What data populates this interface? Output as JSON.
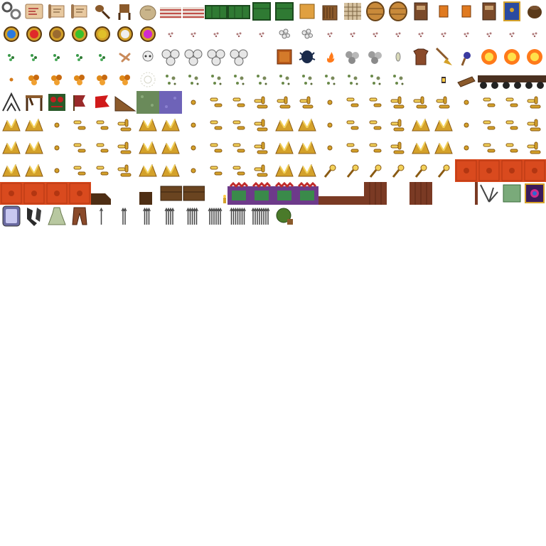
{
  "sheet": {
    "cols": 24,
    "palette": {
      "gold": "#d4a12a",
      "gold_light": "#f2d15a",
      "gold_dark": "#8a5a12",
      "paper": "#e8c9a0",
      "paper_dark": "#a07850",
      "wood": "#8b5a2b",
      "wood_dark": "#4e2e14",
      "green": "#2f7a33",
      "green_dark": "#1c4a1f",
      "stone": "#9c9c9c",
      "stone_light": "#e6e6e6",
      "fire": "#ff7a1a",
      "fire_core": "#ffe14a",
      "red_tile": "#d94a1e",
      "red_tile_dark": "#b23612",
      "purple": "#6d3a8a",
      "blue": "#2a5fb0",
      "moss": "#6a8a4a",
      "lavender": "#6e63b8"
    },
    "rows": [
      [
        "chain",
        "scroll-map",
        "scroll",
        "scroll",
        "spoon",
        "chair",
        "sack",
        "couch-striped",
        "couch-striped",
        "couch-green",
        "couch-green",
        "armchair-green",
        "armchair-green",
        "box",
        "box-open",
        "net",
        "barrel",
        "barrel",
        "book",
        "book-small",
        "book-small",
        "book",
        "book-blue",
        "pot"
      ],
      [
        "orb-blue",
        "orb-red",
        "orb-brown",
        "orb-green",
        "orb-yellow",
        "orb-white",
        "orb-magenta",
        "dust",
        "dust",
        "dust",
        "dust",
        "dust",
        "pebbles",
        "pebbles",
        "dust",
        "dust",
        "dust",
        "dust",
        "dust",
        "dust",
        "dust",
        "dust",
        "dust",
        "dust"
      ],
      [
        "leaf",
        "leaf",
        "leaf",
        "leaf",
        "leaf",
        "bones",
        "skull",
        "skulls",
        "skulls",
        "skulls",
        "skulls",
        "empty",
        "box-orange",
        "spider",
        "fire-small",
        "rubble",
        "rubble",
        "fish",
        "tunic",
        "broom",
        "torch",
        "fireball",
        "fireball",
        "fireball"
      ],
      [
        "dot-orange",
        "ore",
        "ore",
        "ore",
        "ore",
        "ore",
        "cobweb",
        "spores",
        "spores",
        "spores",
        "spores",
        "spores",
        "spores",
        "spores",
        "spores",
        "spores",
        "spores",
        "spores",
        "empty",
        "lantern",
        "log",
        "cart",
        "cart",
        "cart"
      ],
      [
        "tent",
        "loom",
        "idol",
        "flag",
        "flag-red",
        "ramp",
        "moss-tile",
        "lavender-tile",
        "dot-gold",
        "gold-bits",
        "gold-bits",
        "gold-pile",
        "gold-pile",
        "gold-pile",
        "dot-gold",
        "gold-bits",
        "gold-bits",
        "gold-pile",
        "gold-pile",
        "gold-pile",
        "dot-gold",
        "gold-bits",
        "gold-bits",
        "gold-pile"
      ],
      [
        "gold-heap",
        "gold-heap",
        "dot-gold",
        "gold-bits",
        "gold-bits",
        "gold-pile",
        "gold-heap",
        "gold-heap",
        "dot-gold",
        "gold-bits",
        "gold-bits",
        "gold-pile",
        "gold-heap",
        "gold-heap",
        "dot-gold",
        "gold-bits",
        "gold-bits",
        "gold-pile",
        "gold-heap",
        "gold-heap",
        "dot-gold",
        "gold-bits",
        "gold-bits",
        "gold-pile"
      ],
      [
        "gold-heap",
        "gold-heap",
        "dot-gold",
        "gold-bits",
        "gold-bits",
        "gold-pile",
        "gold-heap",
        "gold-heap",
        "dot-gold",
        "gold-bits",
        "gold-bits",
        "gold-pile",
        "gold-heap",
        "gold-heap",
        "dot-gold",
        "gold-bits",
        "gold-bits",
        "gold-pile",
        "gold-heap",
        "gold-heap",
        "dot-gold",
        "gold-bits",
        "gold-bits",
        "gold-pile"
      ],
      [
        "gold-heap",
        "gold-heap",
        "dot-gold",
        "gold-bits",
        "gold-bits",
        "gold-pile",
        "gold-heap",
        "gold-heap",
        "dot-gold",
        "gold-bits",
        "gold-bits",
        "gold-pile",
        "gold-heap",
        "gold-heap",
        "key-gold",
        "key-gold",
        "key-gold",
        "key-gold",
        "key-gold",
        "key-gold",
        "red-tile",
        "red-tile",
        "red-tile",
        "red-tile"
      ],
      [
        "red-tile",
        "red-tile",
        "red-tile",
        "red-tile",
        "crate-broken",
        "empty",
        "crate",
        "cart-wood",
        "cart-wood",
        "candle",
        "ornate-wall",
        "ornate-wall",
        "ornate-wall",
        "ornate-wall",
        "plank-wall",
        "plank-wall",
        "planks",
        "empty",
        "planks",
        "empty",
        "plank-post",
        "spider-web",
        "moss-block",
        "key-iron"
      ],
      [
        "mirror",
        "boots",
        "dress",
        "trousers",
        "arrow",
        "arrow-2",
        "arrow-3",
        "arrow-4",
        "arrow-5",
        "arrow-6",
        "arrow-7",
        "arrow-8",
        "melon",
        "empty",
        "empty",
        "empty",
        "empty",
        "empty",
        "empty",
        "empty",
        "empty",
        "empty",
        "empty",
        "empty"
      ]
    ],
    "last_cell": "spellbook"
  }
}
